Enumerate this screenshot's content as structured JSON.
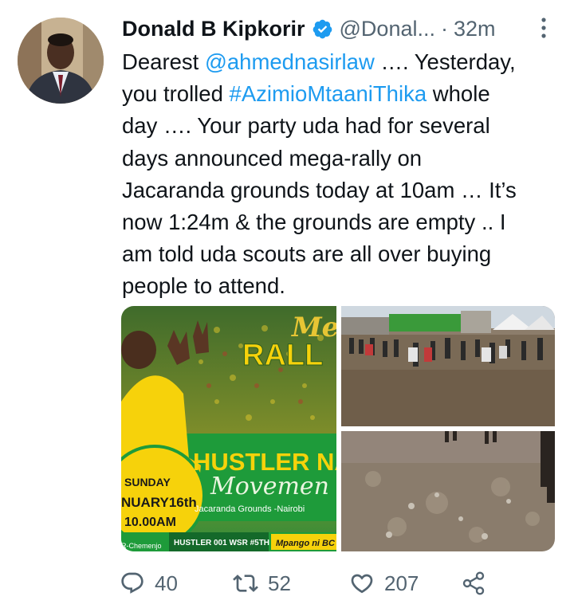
{
  "tweet": {
    "author": {
      "name": "Donald B Kipkorir",
      "handle": "@Donal...",
      "verified_icon": "verified-badge-icon"
    },
    "separator": "·",
    "time": "32m",
    "more_icon": "more-vertical-icon",
    "text": {
      "l1_pre": "Dearest ",
      "l1_mention": "@ahmednasirlaw",
      "l1_post": " …. Yesterday,",
      "l2_pre": "you trolled ",
      "l2_hashtag": "#AzimioMtaaniThika",
      "l2_post": " whole",
      "l3": "day …. Your party uda had for several",
      "l4": "days announced mega-rally on",
      "l5": "Jacaranda grounds today at 10am … It’s",
      "l6": "now 1:24m & the grounds are empty .. I",
      "l7": "am told uda scouts are all over buying",
      "l8": "people to attend."
    },
    "poster": {
      "mega": "Mega",
      "rally": "RALL",
      "hustler": "HUSTLER NATI",
      "movement": "Movemen",
      "day": "SUNDAY",
      "date": "NUARY16th",
      "time": "10.00AM",
      "venue": "Jacaranda Grounds -Nairobi",
      "tag": "HUSTLER 001 WSR #5TH",
      "slogan": "Mpango ni BC",
      "credit": "R-Chemenjo"
    },
    "actions": {
      "reply_count": "40",
      "retweet_count": "52",
      "like_count": "207"
    },
    "colors": {
      "link": "#1d9bf0",
      "text": "#0f1419",
      "secondary": "#536471",
      "poster_yellow": "#f6d20b",
      "poster_green": "#1e9b3a"
    }
  }
}
